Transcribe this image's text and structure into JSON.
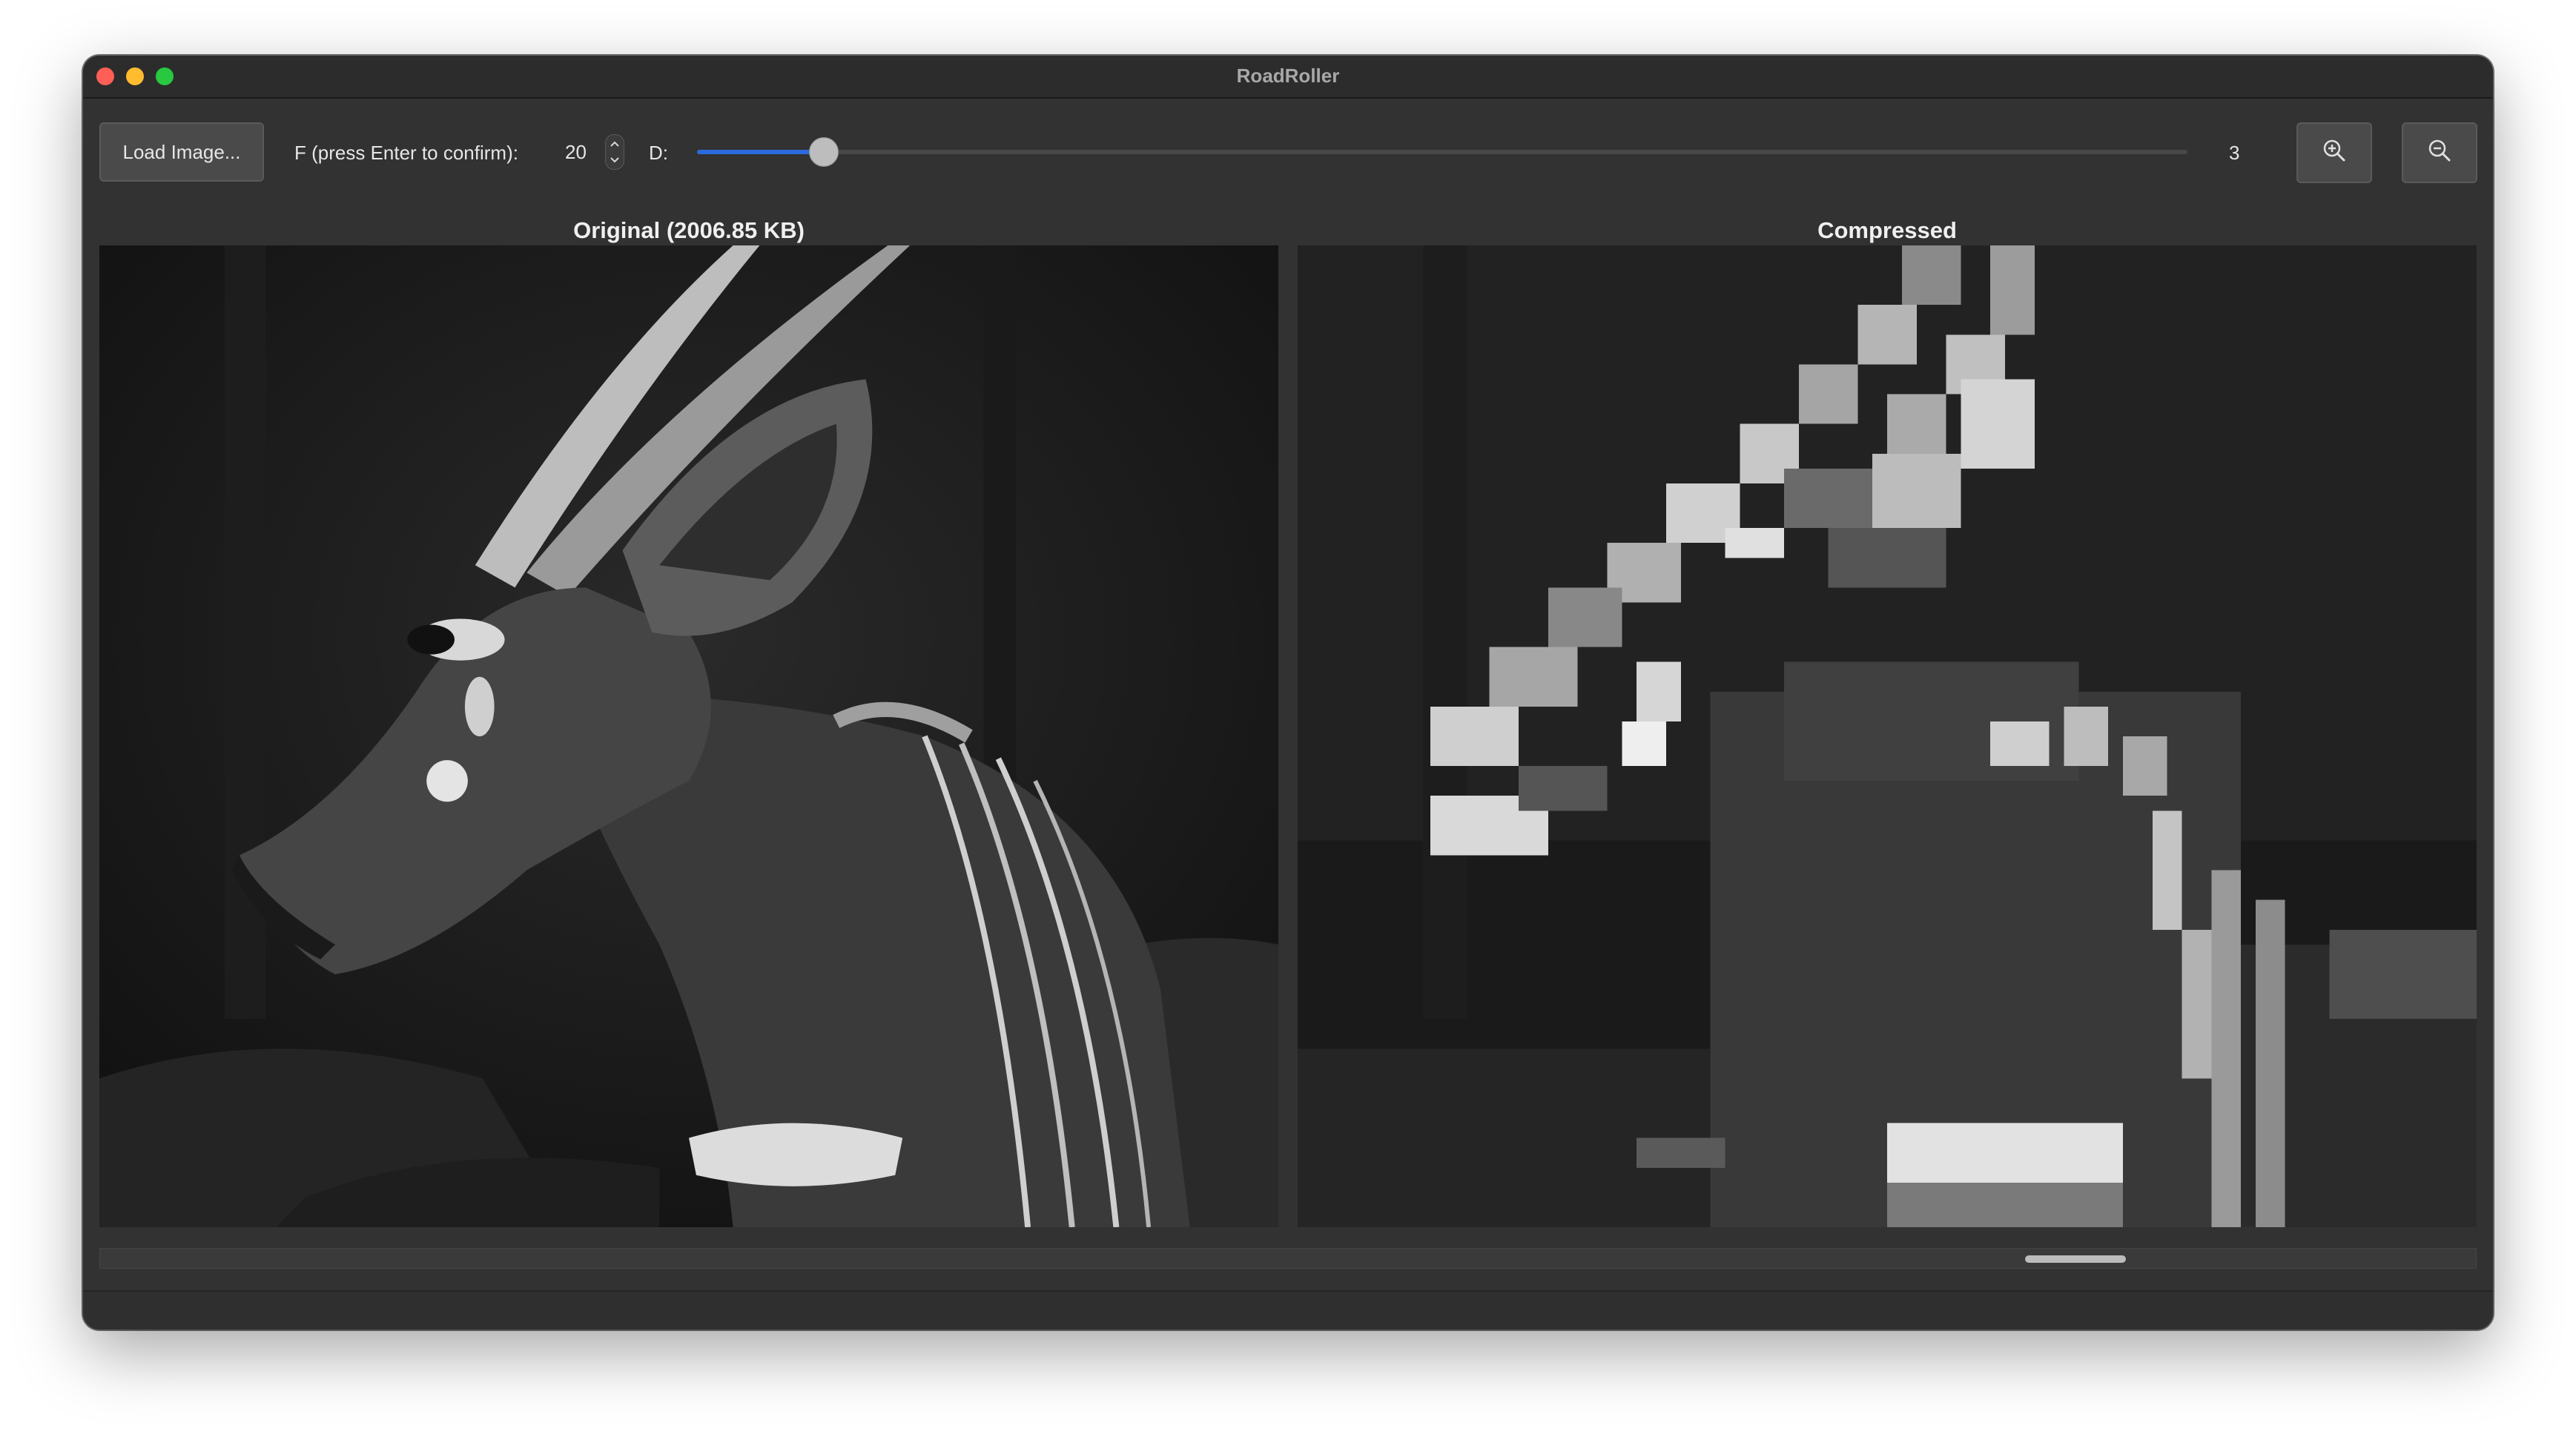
{
  "window": {
    "title": "RoadRoller"
  },
  "toolbar": {
    "load_label": "Load Image...",
    "f_label": "F (press Enter to confirm):",
    "f_value": "20",
    "d_label": "D:",
    "d_value": "3",
    "d_slider_fraction": 0.085,
    "zoom_in_icon": "zoom-in-icon",
    "zoom_out_icon": "zoom-out-icon"
  },
  "panels": {
    "original_title": "Original (2006.85 KB)",
    "compressed_title": "Compressed"
  },
  "colors": {
    "window_bg": "#323232",
    "slider_accent": "#2b6bdb",
    "close": "#ff5f57",
    "minimize": "#febc2e",
    "maximize": "#28c840"
  }
}
